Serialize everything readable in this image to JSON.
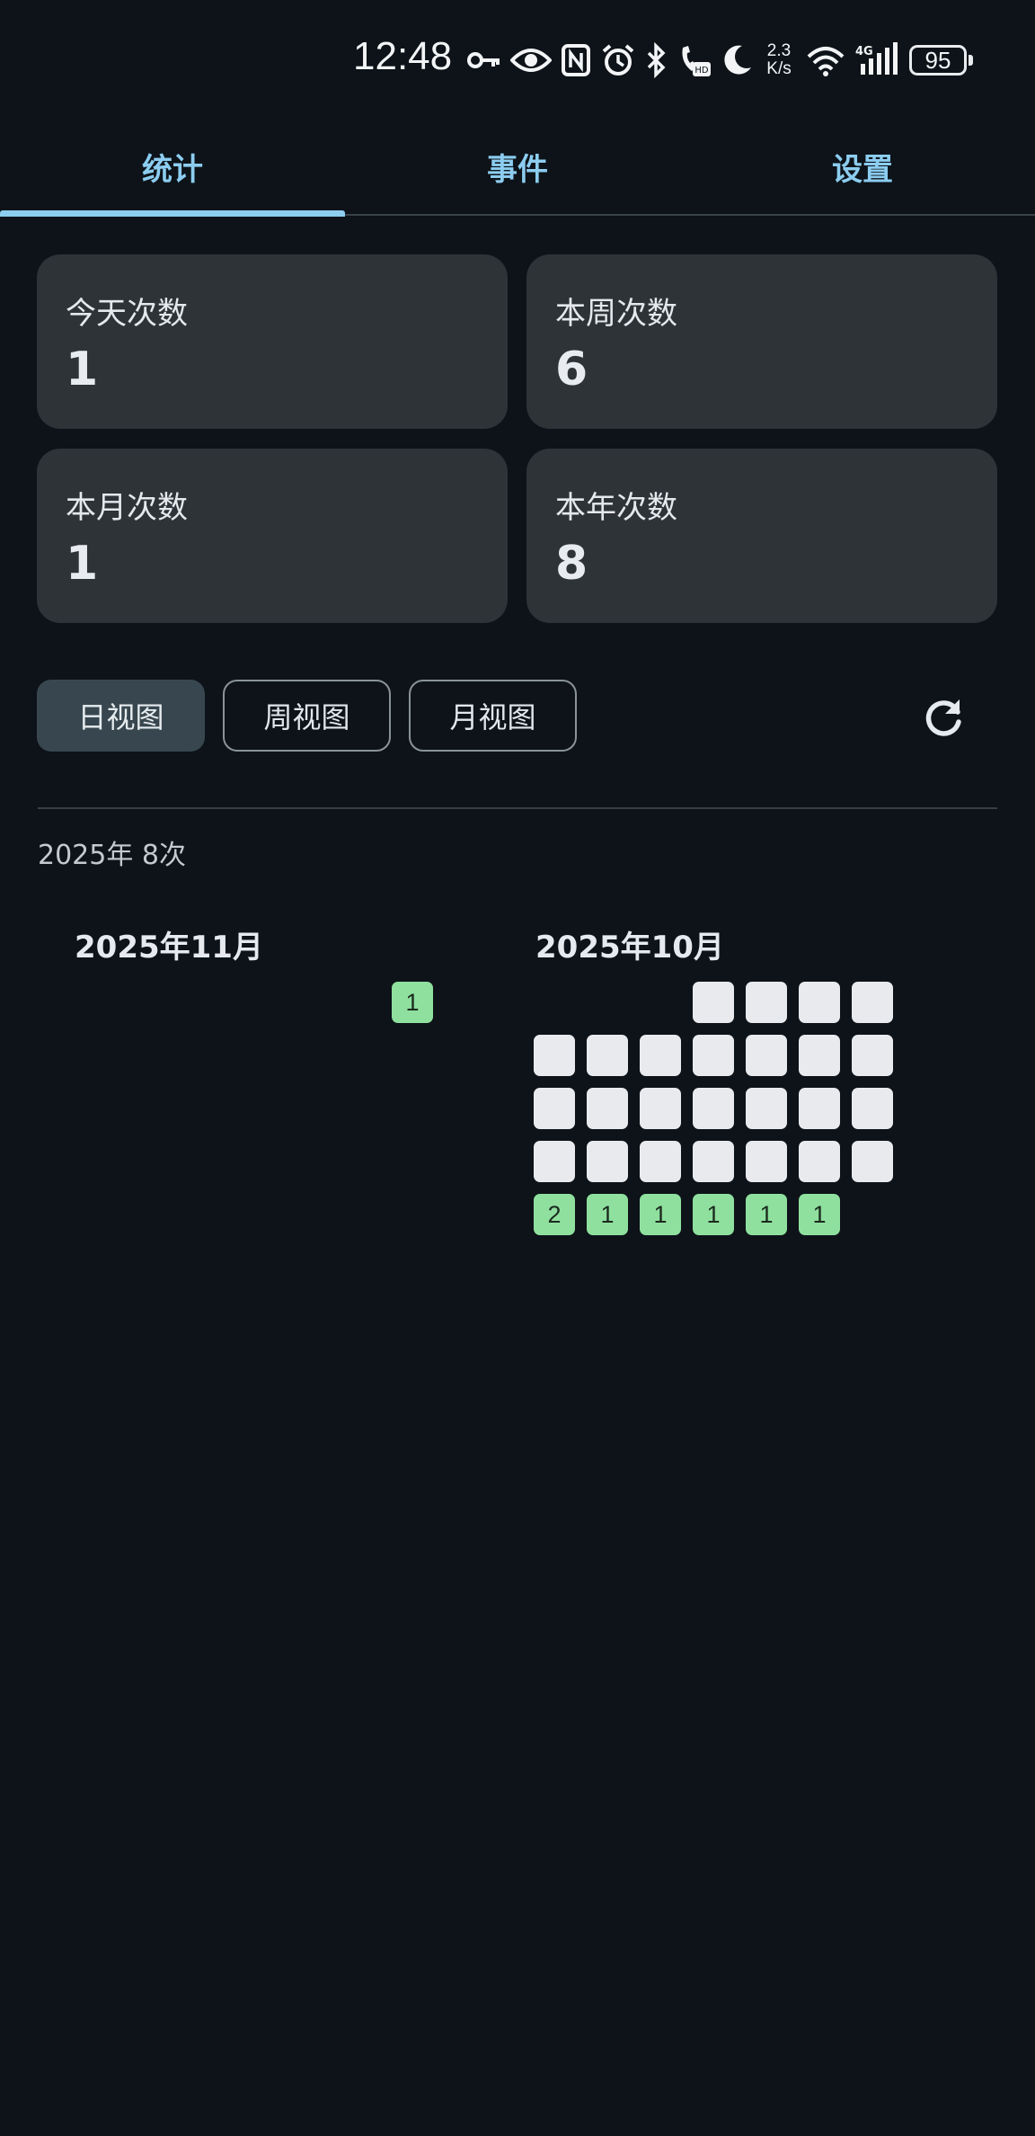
{
  "status_bar": {
    "time": "12:48",
    "net_speed_value": "2.3",
    "net_speed_unit": "K/s",
    "battery": "95",
    "icons": [
      "vpn-key-icon",
      "eye-icon",
      "nfc-icon",
      "alarm-icon",
      "bluetooth-icon",
      "hd-call-icon",
      "moon-icon",
      "wifi-icon",
      "signal-4g-icon",
      "battery-icon"
    ]
  },
  "tabs": [
    {
      "label": "统计",
      "active": true
    },
    {
      "label": "事件",
      "active": false
    },
    {
      "label": "设置",
      "active": false
    }
  ],
  "stats": [
    {
      "label": "今天次数",
      "value": "1"
    },
    {
      "label": "本周次数",
      "value": "6"
    },
    {
      "label": "本月次数",
      "value": "1"
    },
    {
      "label": "本年次数",
      "value": "8"
    }
  ],
  "view_buttons": [
    {
      "label": "日视图",
      "active": true
    },
    {
      "label": "周视图",
      "active": false
    },
    {
      "label": "月视图",
      "active": false
    }
  ],
  "refresh_icon": "refresh-icon",
  "year_summary": "2025年 8次",
  "months": [
    {
      "title": "2025年11月",
      "active_counts": [
        "1"
      ]
    },
    {
      "title": "2025年10月",
      "active_counts": [
        "2",
        "1",
        "1",
        "1",
        "1",
        "1"
      ]
    }
  ],
  "colors": {
    "background": "#0d1319",
    "accent": "#8ccdf0",
    "card": "#2e3338",
    "cell_empty": "#e8eaee",
    "cell_active": "#8fe09e"
  }
}
